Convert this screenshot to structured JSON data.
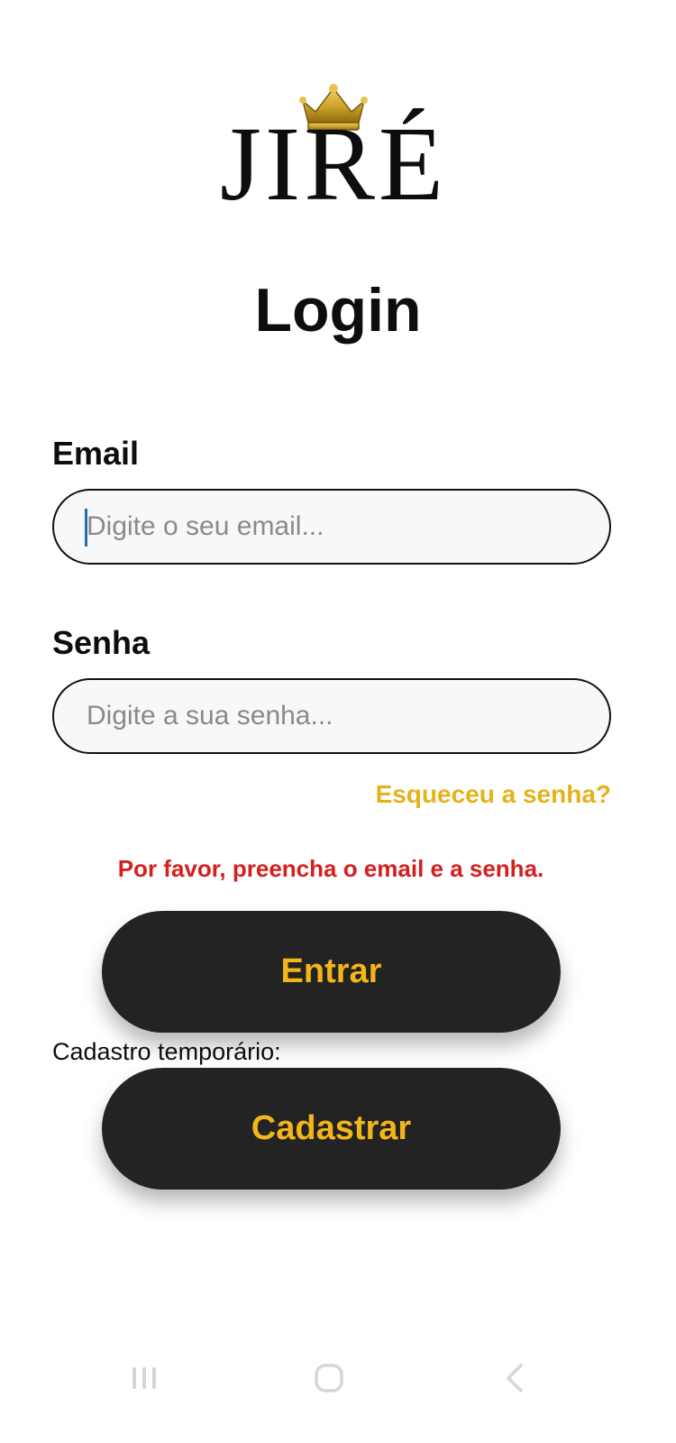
{
  "logo": {
    "text": "JIRÉ",
    "crown_icon": "crown-icon",
    "crown_color": "#c9a227"
  },
  "page": {
    "title": "Login"
  },
  "email": {
    "label": "Email",
    "placeholder": "Digite o seu email..."
  },
  "password": {
    "label": "Senha",
    "placeholder": "Digite a sua senha..."
  },
  "forgot_password": "Esqueceu a senha?",
  "error_message": "Por favor, preencha o email e a senha.",
  "buttons": {
    "login": "Entrar",
    "register": "Cadastrar"
  },
  "temporary_signup_label": "Cadastro temporário:",
  "nav_bar": {
    "recents_icon": "recents-icon",
    "home_icon": "home-icon",
    "back_icon": "back-icon"
  },
  "colors": {
    "accent": "#f2b51a",
    "link": "#e6b21a",
    "error": "#d61f1f",
    "button_bg": "#232323"
  }
}
